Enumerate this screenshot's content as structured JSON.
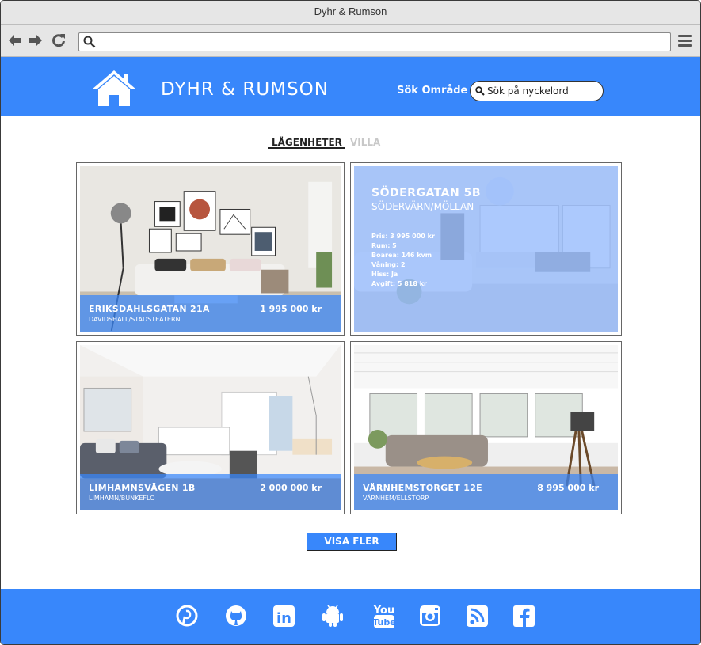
{
  "window": {
    "title": "Dyhr & Rumson"
  },
  "browser": {
    "url": ""
  },
  "header": {
    "brand": "DYHR & RUMSON",
    "search_label": "Sök Område",
    "search_placeholder": "Sök på nyckelord"
  },
  "tabs": {
    "active": "LÄGENHETER",
    "inactive": "VILLA"
  },
  "listings": [
    {
      "street": "ERIKSDAHLSGATAN 21A",
      "area": "DAVIDSHALL/STADSTEATERN",
      "price": "1 995 000 kr"
    },
    {
      "street": "SÖDERGATAN 5B",
      "area": "SÖDERVÄRN/MÖLLAN",
      "facts": [
        "Pris: 3 995 000 kr",
        "Rum: 5",
        "Boarea: 146 kvm",
        "Våning: 2",
        "Hiss: Ja",
        "Avgift: 5 818 kr"
      ]
    },
    {
      "street": "LIMHAMNSVÄGEN 1B",
      "area": "LIMHAMN/BUNKEFLO",
      "price": "2 000 000 kr"
    },
    {
      "street": "VÄRNHEMSTORGET 12E",
      "area": "VÄRNHEM/ELLSTORP",
      "price": "8 995 000 kr"
    }
  ],
  "more_button": "VISA FLER",
  "footer": {
    "icons": [
      "pinterest-icon",
      "github-icon",
      "linkedin-icon",
      "android-icon",
      "youtube-icon",
      "instagram-icon",
      "rss-icon",
      "facebook-icon"
    ],
    "youtube_text": [
      "You",
      "Tube"
    ],
    "linkedin_text": "in"
  },
  "colors": {
    "accent": "#3887fb",
    "overlay": "#3887fb"
  }
}
